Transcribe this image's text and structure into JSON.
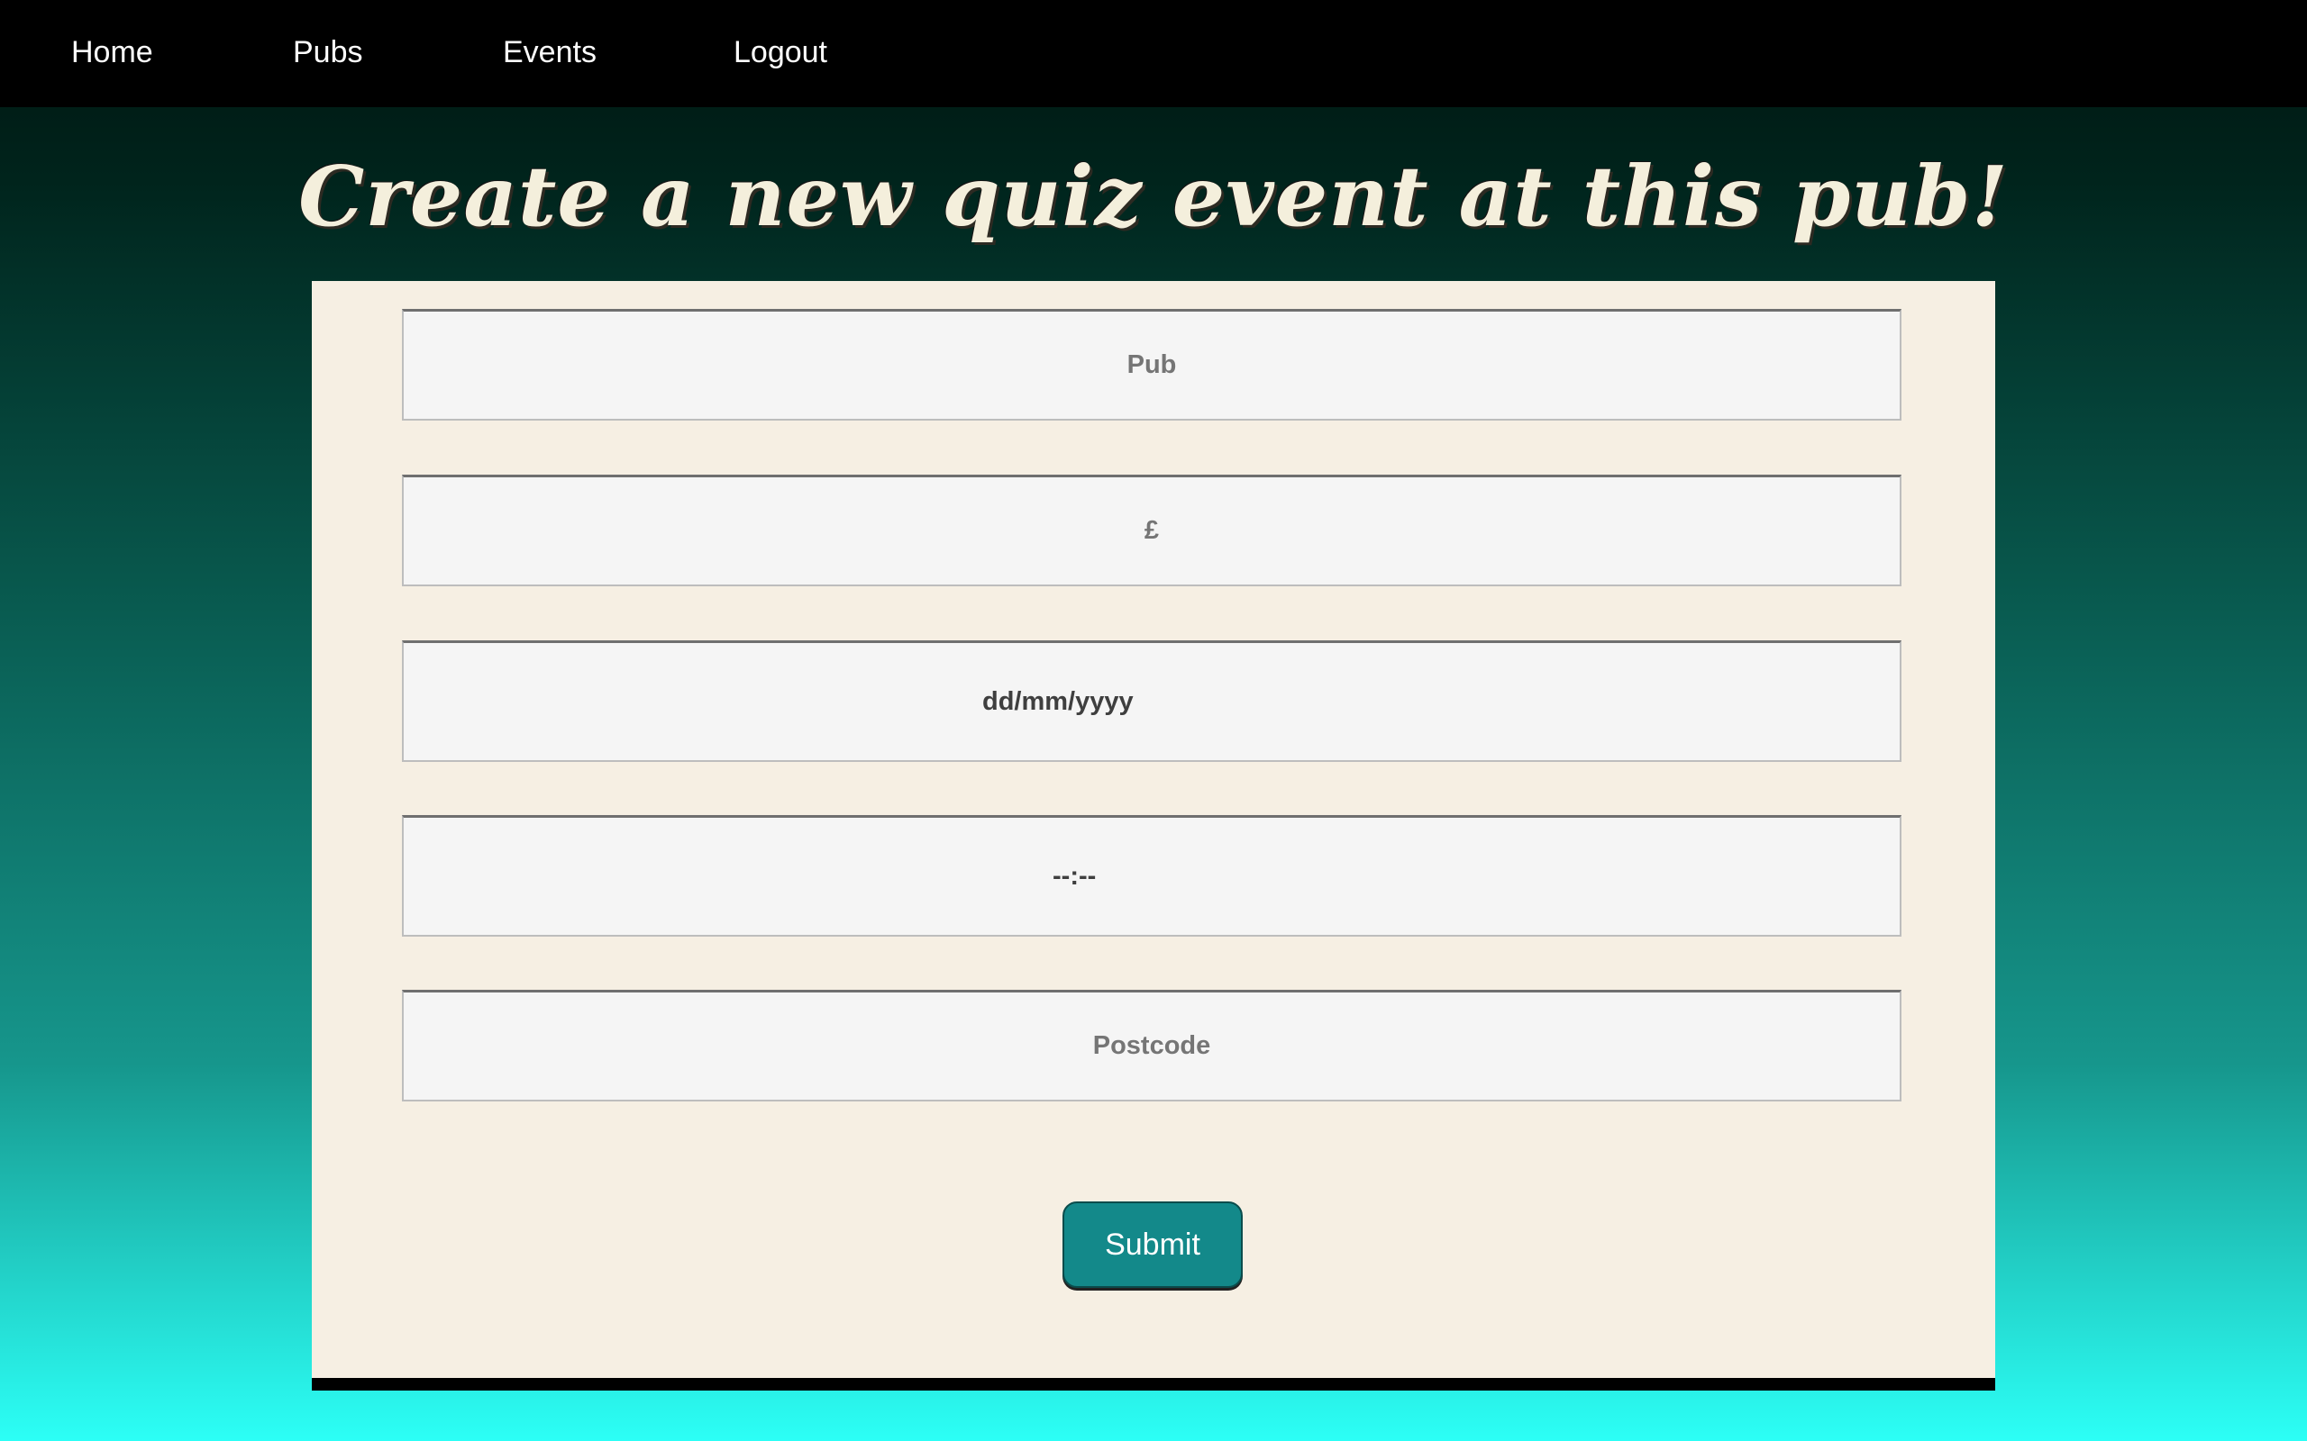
{
  "nav": {
    "items": [
      {
        "label": "Home"
      },
      {
        "label": "Pubs"
      },
      {
        "label": "Events"
      },
      {
        "label": "Logout"
      }
    ]
  },
  "page": {
    "title": "Create a new quiz event at this pub!"
  },
  "form": {
    "pub": {
      "placeholder": "Pub"
    },
    "price": {
      "placeholder": "£"
    },
    "date": {
      "value": "dd/mm/yyyy"
    },
    "time": {
      "value": "--:--"
    },
    "postcode": {
      "placeholder": "Postcode"
    },
    "submit_label": "Submit"
  },
  "colors": {
    "nav_background": "#000000",
    "panel_background": "#f6efe3",
    "button_background": "#13898a",
    "title_text": "#f4efdc",
    "gradient_top": "#00140f",
    "gradient_bottom": "#2cfff6"
  }
}
